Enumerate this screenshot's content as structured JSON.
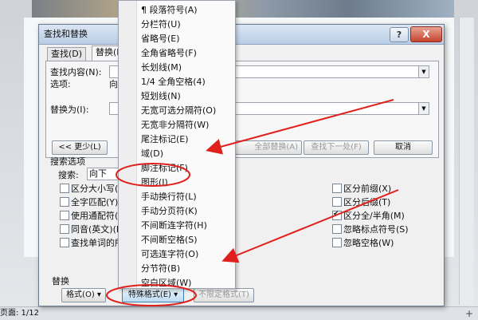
{
  "statusbar": {
    "page": "页面: 1/12",
    "plus": "+"
  },
  "dialog": {
    "title": "查找和替换",
    "help": "?",
    "close": "X",
    "tabs": [
      {
        "label": "查找(D)"
      },
      {
        "label": "替换(P"
      }
    ],
    "find_label": "查找内容(N):",
    "options_label": "选项:",
    "options_value": "向下",
    "replace_label": "替换为(I):",
    "less_button": "<< 更少(L)",
    "replace_all_button": "全部替换(A)",
    "find_next_button": "查找下一处(F)",
    "cancel_button": "取消",
    "search_options_title": "搜索选项",
    "search_label": "搜索:",
    "search_value": "向下",
    "left_options": [
      {
        "label": "区分大小写(H",
        "checked": false
      },
      {
        "label": "全字匹配(Y)",
        "checked": false
      },
      {
        "label": "使用通配符(U",
        "checked": false
      },
      {
        "label": "同音(英文)(K",
        "checked": false
      },
      {
        "label": "查找单词的所",
        "checked": false
      }
    ],
    "right_options": [
      {
        "label": "区分前缀(X)",
        "checked": false
      },
      {
        "label": "区分后缀(T)",
        "checked": false
      },
      {
        "label": "区分全/半角(M)",
        "checked": true
      },
      {
        "label": "忽略标点符号(S)",
        "checked": false
      },
      {
        "label": "忽略空格(W)",
        "checked": false
      }
    ],
    "replace_section": "替换",
    "format_button": "格式(O) ▾",
    "special_button": "特殊格式(E) ▾",
    "no_format_button": "不限定格式(T)"
  },
  "menu": {
    "items": [
      "¶ 段落符号(A)",
      "分栏符(U)",
      "省略号(E)",
      "全角省略号(F)",
      "长划线(M)",
      "1/4 全角空格(4)",
      "短划线(N)",
      "无宽可选分隔符(O)",
      "无宽非分隔符(W)",
      "尾注标记(E)",
      "域(D)",
      "脚注标记(F)",
      "图形(I)",
      "手动换行符(L)",
      "手动分页符(K)",
      "不间断连字符(H)",
      "不间断空格(S)",
      "可选连字符(O)",
      "分节符(B)",
      "空白区域(W)"
    ]
  },
  "colors": {
    "annotation": "#e0201c",
    "titlebar": "#c6d7ec"
  }
}
